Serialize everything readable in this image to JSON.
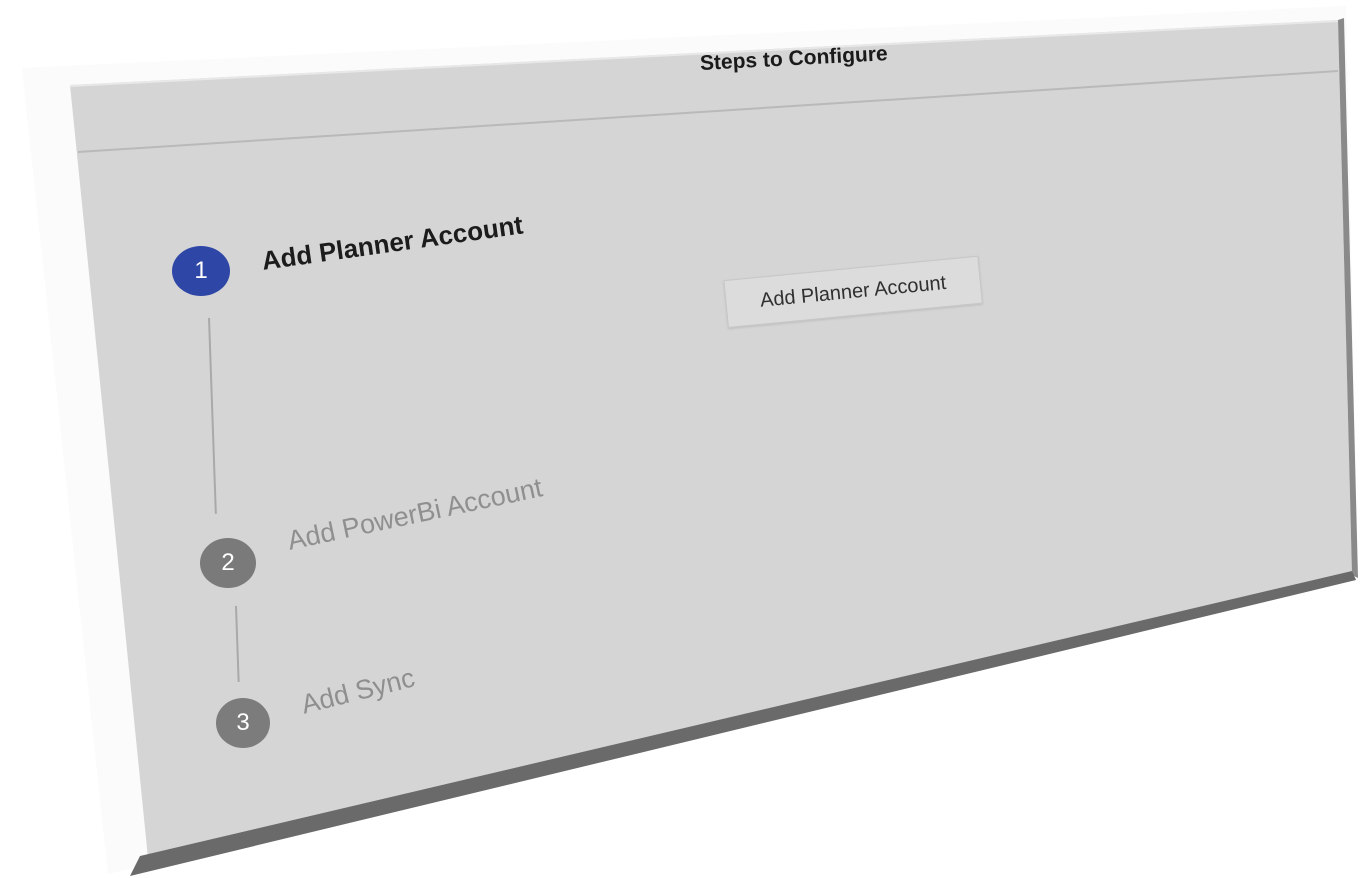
{
  "dialog": {
    "title": "Steps to Configure"
  },
  "steps": [
    {
      "number": "1",
      "label": "Add Planner Account",
      "state": "active",
      "color": "#2e46a6"
    },
    {
      "number": "2",
      "label": "Add PowerBi Account",
      "state": "inactive",
      "color": "#7a7a7a"
    },
    {
      "number": "3",
      "label": "Add Sync",
      "state": "inactive",
      "color": "#7c7c7c"
    }
  ],
  "actions": {
    "add_planner_account_button": "Add Planner Account"
  }
}
